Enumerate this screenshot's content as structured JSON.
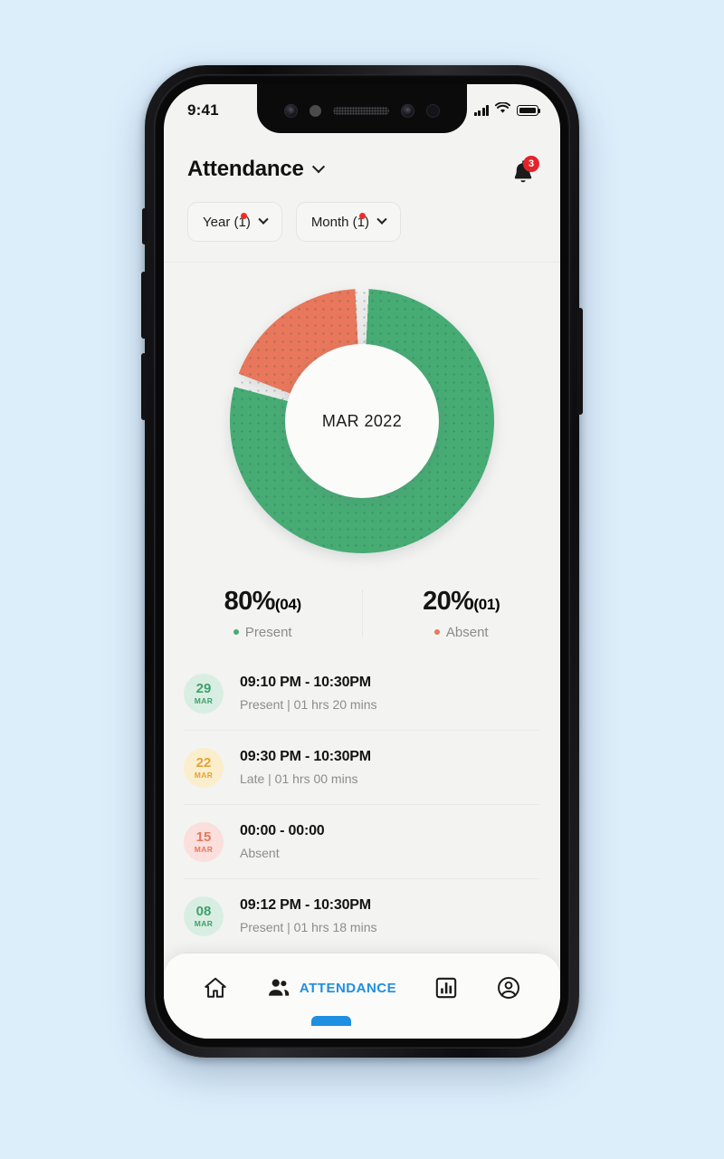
{
  "colors": {
    "page_background": "#ddeefb",
    "screen_background": "#f3f3f1",
    "present_green": "#47ab74",
    "absent_coral": "#e8775c",
    "late_amber": "#e8a33c",
    "accent_blue": "#1e8fe1",
    "badge_red": "#e3242b"
  },
  "status_bar": {
    "time": "9:41",
    "signal_icon": "signal-bars-icon",
    "wifi_icon": "wifi-icon",
    "battery_icon": "battery-full-icon"
  },
  "header": {
    "title": "Attendance",
    "title_chevron_icon": "chevron-down-icon",
    "bell_icon": "notification-bell-icon",
    "bell_badge_count": "3"
  },
  "filters": [
    {
      "label": "Year (1)",
      "name": "year-filter-chip",
      "has_dot": true,
      "chevron_icon": "chevron-down-icon"
    },
    {
      "label": "Month (1)",
      "name": "month-filter-chip",
      "has_dot": true,
      "chevron_icon": "chevron-down-icon"
    }
  ],
  "chart_data": {
    "type": "pie",
    "title": "MAR 2022",
    "center_label": "MAR 2022",
    "categories": [
      "Present",
      "Absent"
    ],
    "values": [
      80,
      20
    ],
    "counts": [
      "04",
      "01"
    ],
    "colors": [
      "#47ab74",
      "#e8775c"
    ],
    "unit": "%",
    "legend_position": "below",
    "donut": true,
    "inner_radius_ratio": 0.58,
    "gap_degrees": 6,
    "start_angle_degrees": 0
  },
  "stats": [
    {
      "value": "80%",
      "count": "(04)",
      "legend": "Present",
      "color": "#47ab74",
      "name": "stat-present"
    },
    {
      "value": "20%",
      "count": "(01)",
      "legend": "Absent",
      "color": "#e8775c",
      "name": "stat-absent"
    }
  ],
  "attendance_list": [
    {
      "day": "29",
      "month": "MAR",
      "time": "09:10 PM - 10:30PM",
      "meta": "Present | 01 hrs 20 mins",
      "badge_bg": "#d9eee2",
      "badge_fg": "#3fa06e"
    },
    {
      "day": "22",
      "month": "MAR",
      "time": "09:30 PM - 10:30PM",
      "meta": "Late | 01 hrs 00 mins",
      "badge_bg": "#faeecd",
      "badge_fg": "#e3a23a"
    },
    {
      "day": "15",
      "month": "MAR",
      "time": "00:00 - 00:00",
      "meta": "Absent",
      "badge_bg": "#fadfdc",
      "badge_fg": "#e8775c"
    },
    {
      "day": "08",
      "month": "MAR",
      "time": "09:12 PM - 10:30PM",
      "meta": "Present | 01 hrs 18 mins",
      "badge_bg": "#d9eee2",
      "badge_fg": "#3fa06e"
    }
  ],
  "bottom_nav": {
    "active_label": "ATTENDANCE",
    "items": [
      {
        "name": "nav-home",
        "icon": "home-icon",
        "active": false
      },
      {
        "name": "nav-attendance",
        "icon": "people-icon",
        "active": true
      },
      {
        "name": "nav-reports",
        "icon": "bar-chart-icon",
        "active": false
      },
      {
        "name": "nav-profile",
        "icon": "account-circle-icon",
        "active": false
      }
    ]
  }
}
